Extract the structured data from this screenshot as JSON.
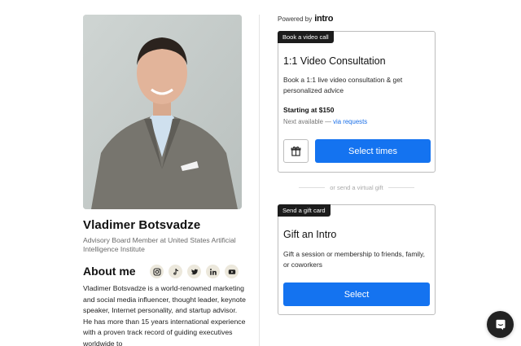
{
  "profile": {
    "name": "Vladimer Botsvadze",
    "subtitle": "Advisory Board Member at United States Artificial Intelligence Institute",
    "about_title": "About me",
    "bio": "Vladimer Botsvadze is a world-renowned marketing and social media influencer, thought leader, keynote speaker, Internet personality, and startup advisor. He has more than 15 years international experience with a proven track record of guiding executives worldwide to",
    "socials": [
      {
        "icon": "instagram-icon"
      },
      {
        "icon": "tiktok-icon"
      },
      {
        "icon": "twitter-icon"
      },
      {
        "icon": "linkedin-icon"
      },
      {
        "icon": "youtube-icon"
      }
    ]
  },
  "powered_by": {
    "label": "Powered by",
    "brand": "intro"
  },
  "video_card": {
    "tag": "Book a video call",
    "title": "1:1 Video Consultation",
    "description": "Book a 1:1 live video consultation & get personalized advice",
    "price": "Starting at $150",
    "availability_prefix": "Next available —",
    "availability_link": "via requests",
    "gift_icon": "gift-icon",
    "button_label": "Select times"
  },
  "separator": {
    "text": "or send a virtual gift"
  },
  "gift_card": {
    "tag": "Send a gift card",
    "title": "Gift an Intro",
    "description": "Gift a session or membership to friends, family, or coworkers",
    "button_label": "Select"
  },
  "chat": {
    "icon": "chat-icon"
  },
  "colors": {
    "accent": "#1473f0",
    "tag_bg": "#1c1c1c",
    "social_bg": "#ece8dc"
  }
}
